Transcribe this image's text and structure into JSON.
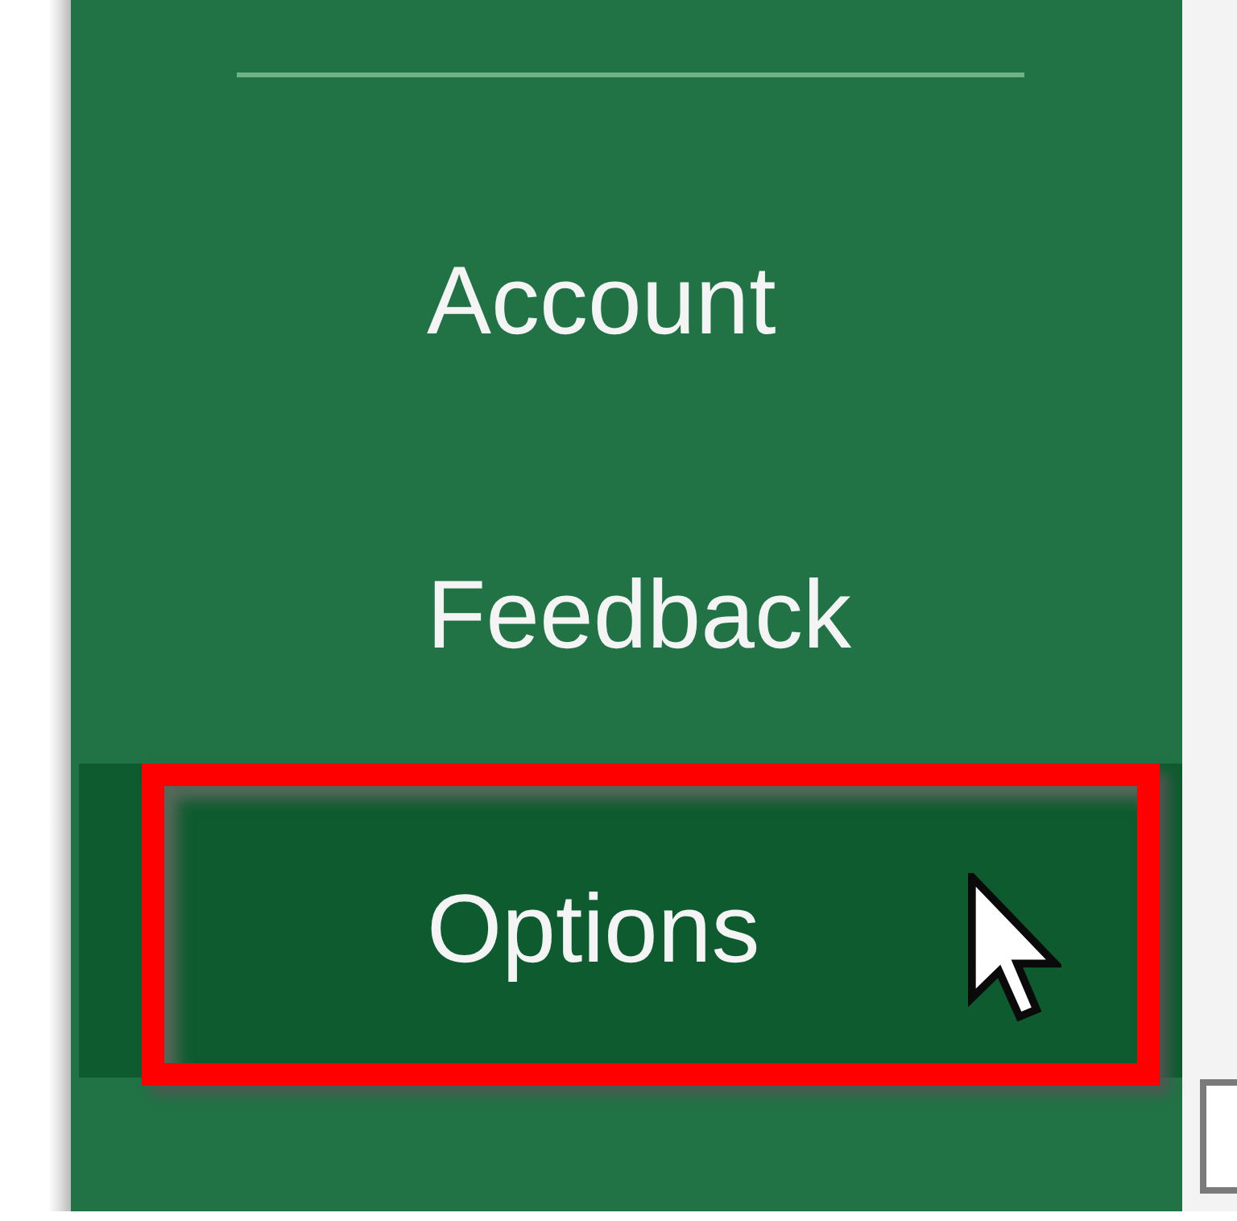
{
  "menu": {
    "items": [
      {
        "label": "Account",
        "selected": false,
        "highlighted": false
      },
      {
        "label": "Feedback",
        "selected": false,
        "highlighted": false
      },
      {
        "label": "Options",
        "selected": true,
        "highlighted": true
      }
    ]
  }
}
